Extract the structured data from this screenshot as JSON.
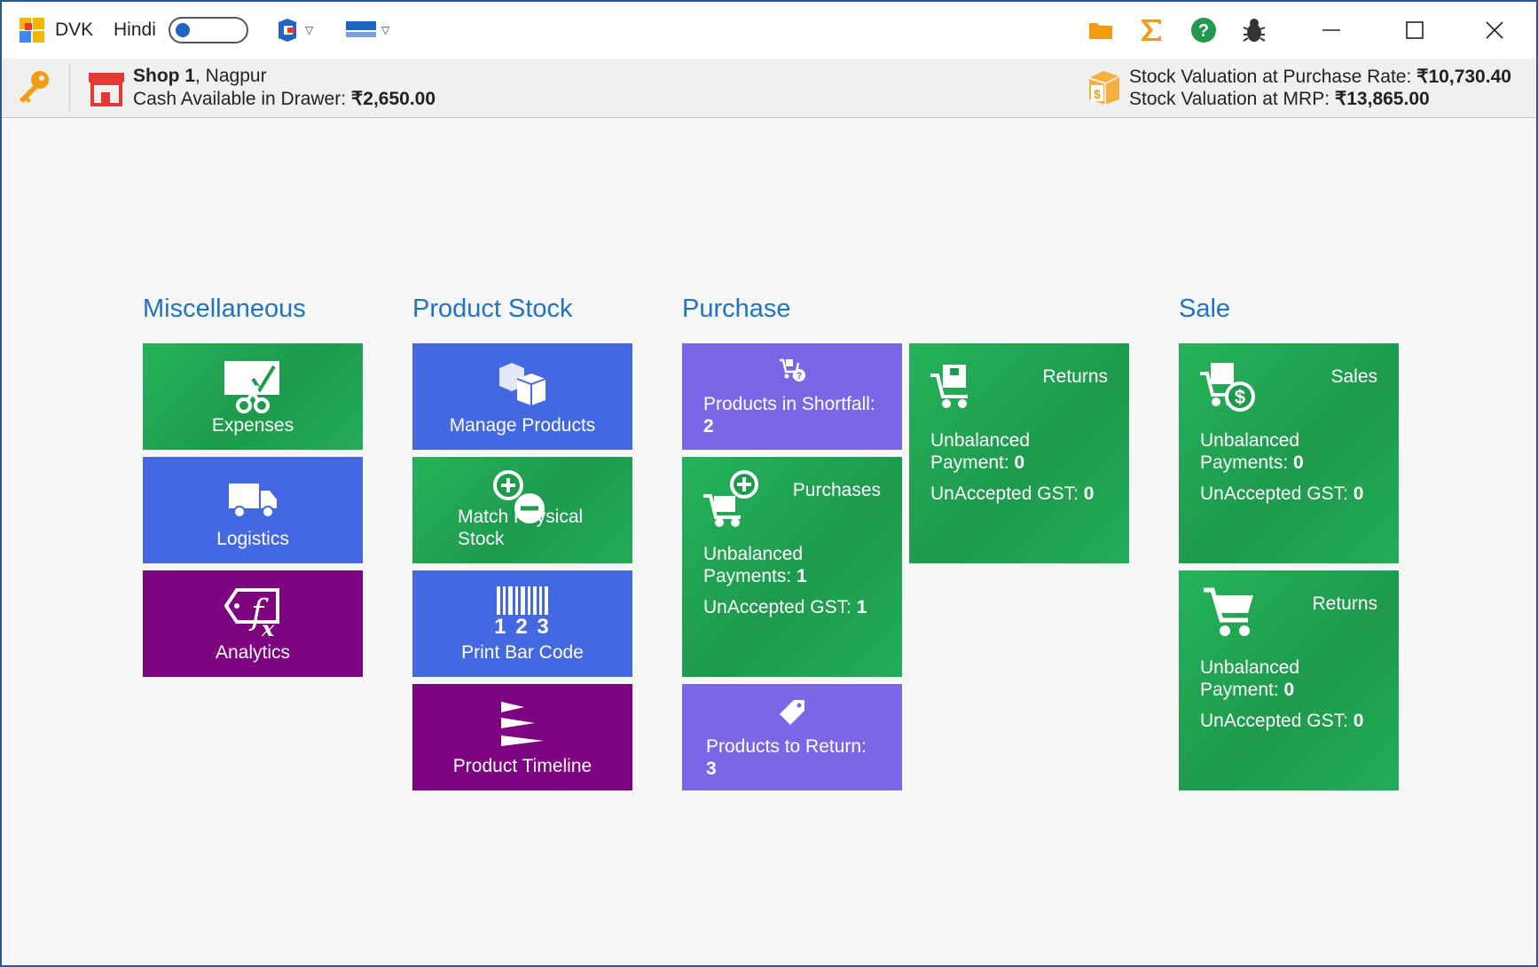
{
  "titlebar": {
    "app_name": "DVK",
    "language_label": "Hindi",
    "brand_colors": {
      "accent": "#1f73c4",
      "folder": "#f39c12",
      "sigma": "#f39c12",
      "help": "#1e9a4d"
    }
  },
  "infobar": {
    "shop_name": "Shop 1",
    "shop_city": ", Nagpur",
    "cash_label": "Cash Available in Drawer: ",
    "cash_value": "₹2,650.00",
    "stock_purchase_label": "Stock Valuation at Purchase Rate: ",
    "stock_purchase_value": "₹10,730.40",
    "stock_mrp_label": "Stock Valuation at MRP: ",
    "stock_mrp_value": "₹13,865.00"
  },
  "sections": {
    "misc": {
      "title": "Miscellaneous",
      "expenses": "Expenses",
      "logistics": "Logistics",
      "analytics": "Analytics"
    },
    "stock": {
      "title": "Product Stock",
      "manage": "Manage Products",
      "match_line1": "Match Physical",
      "match_line2": "Stock",
      "barcode_digits": "1 2 3",
      "barcode": "Print Bar Code",
      "timeline": "Product Timeline"
    },
    "purchase": {
      "title": "Purchase",
      "shortfall_label": "Products in Shortfall:",
      "shortfall_value": "2",
      "purchases_head": "Purchases",
      "purchases_unbalanced_1": "Unbalanced",
      "purchases_unbalanced_2": "Payments: ",
      "purchases_unbalanced_value": "1",
      "purchases_gst_label": "UnAccepted GST: ",
      "purchases_gst_value": "1",
      "return_label": "Products to Return:",
      "return_value": "3",
      "returns_head": "Returns",
      "returns_unbalanced_1": "Unbalanced",
      "returns_unbalanced_2": "Payment: ",
      "returns_unbalanced_value": "0",
      "returns_gst_label": "UnAccepted GST: ",
      "returns_gst_value": "0"
    },
    "sale": {
      "title": "Sale",
      "sales_head": "Sales",
      "sales_unbalanced_1": "Unbalanced",
      "sales_unbalanced_2": "Payments: ",
      "sales_unbalanced_value": "0",
      "sales_gst_label": "UnAccepted GST: ",
      "sales_gst_value": "0",
      "returns_head": "Returns",
      "returns_unbalanced_1": "Unbalanced",
      "returns_unbalanced_2": "Payment: ",
      "returns_unbalanced_value": "0",
      "returns_gst_label": "UnAccepted GST: ",
      "returns_gst_value": "0"
    }
  }
}
